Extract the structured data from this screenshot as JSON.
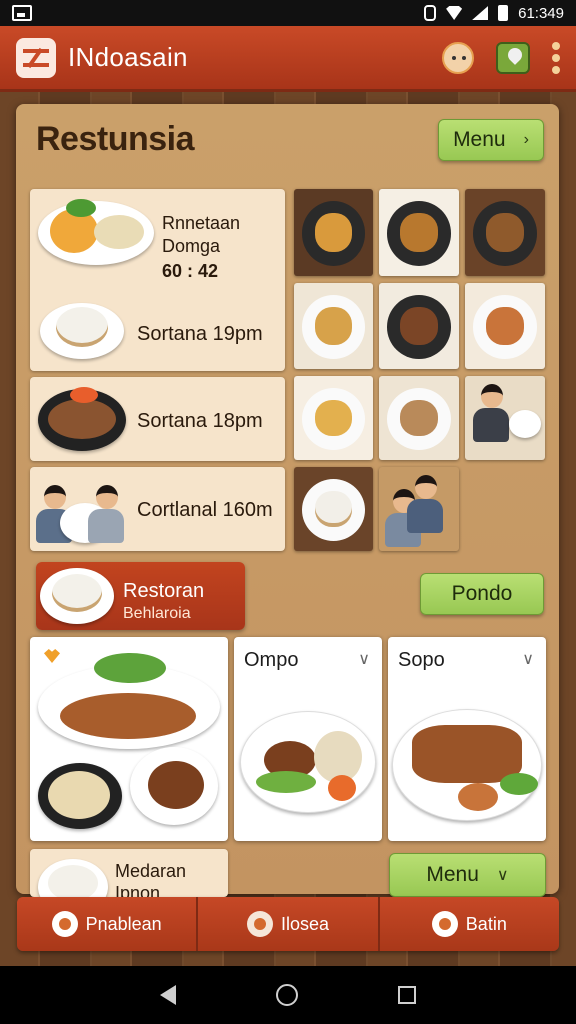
{
  "status_bar": {
    "time": "61:349"
  },
  "app_bar": {
    "title": "INdoasain"
  },
  "section": {
    "title": "Restunsia",
    "menu_button": "Menu"
  },
  "left_cards": [
    {
      "line1": "Rnnetaan",
      "line2": "Domga",
      "line3": "60 : 42",
      "line4": "Sortana 19pm"
    },
    {
      "label": "Sortana 18pm"
    },
    {
      "label": "Cortlanal 160m"
    }
  ],
  "restoran": {
    "title": "Restoran",
    "subtitle": "Behlaroia",
    "action_button": "Pondo"
  },
  "dish_cards": [
    {
      "title": ""
    },
    {
      "title": "Ompo"
    },
    {
      "title": "Sopo"
    }
  ],
  "bottom_card": {
    "line1": "Medaran",
    "line2": "Ipnon",
    "menu_button": "Menu"
  },
  "bottom_nav": [
    {
      "label": "Pnablean"
    },
    {
      "label": "Ilosea"
    },
    {
      "label": "Batin"
    }
  ]
}
